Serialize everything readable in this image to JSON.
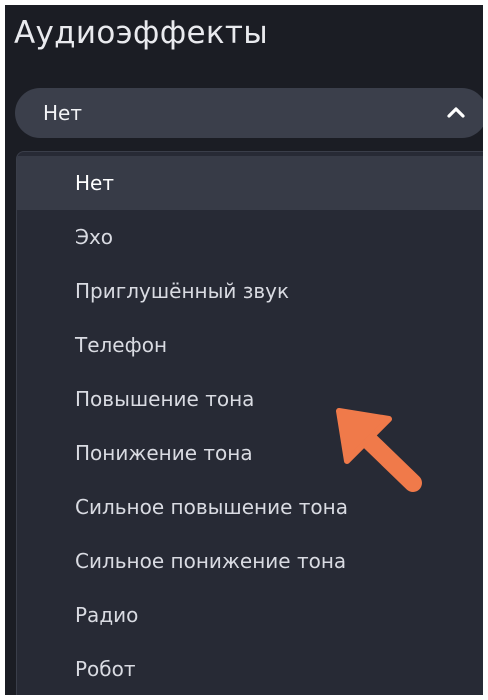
{
  "panel": {
    "title": "Аудиоэффекты"
  },
  "select": {
    "value": "Нет",
    "icon": "chevron-up-icon"
  },
  "menu": {
    "items": [
      {
        "label": "Нет",
        "selected": true
      },
      {
        "label": "Эхо",
        "selected": false
      },
      {
        "label": "Приглушённый звук",
        "selected": false
      },
      {
        "label": "Телефон",
        "selected": false
      },
      {
        "label": "Повышение тона",
        "selected": false
      },
      {
        "label": "Понижение тона",
        "selected": false
      },
      {
        "label": "Сильное повышение тона",
        "selected": false
      },
      {
        "label": "Сильное понижение тона",
        "selected": false
      },
      {
        "label": "Радио",
        "selected": false
      },
      {
        "label": "Робот",
        "selected": false
      }
    ]
  },
  "annotation": {
    "icon": "pointer-arrow-icon",
    "color": "#f07a4a"
  },
  "colors": {
    "panel_bg": "#1b1d24",
    "select_bg": "#3b3f4b",
    "menu_bg": "#272a35",
    "selected_bg": "#373b47",
    "text": "#d9dbe2"
  }
}
